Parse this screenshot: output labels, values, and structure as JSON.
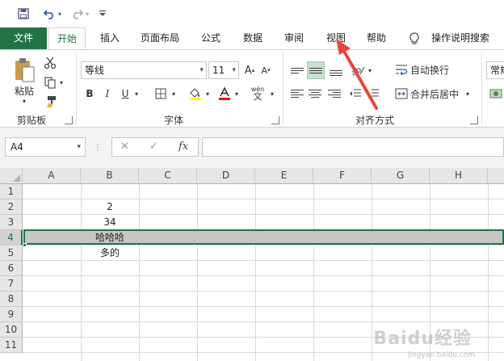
{
  "tabs": [
    {
      "label": "文件"
    },
    {
      "label": "开始"
    },
    {
      "label": "插入"
    },
    {
      "label": "页面布局"
    },
    {
      "label": "公式"
    },
    {
      "label": "数据"
    },
    {
      "label": "审阅"
    },
    {
      "label": "视图"
    },
    {
      "label": "帮助"
    },
    {
      "label": "操作说明搜索"
    }
  ],
  "ribbon": {
    "paste_label": "粘贴",
    "clipboard_group": "剪贴板",
    "font_name": "等线",
    "font_size": "11",
    "font_group": "字体",
    "bold": "B",
    "italic": "I",
    "underline": "U",
    "wen": "wén",
    "wrap_text": "自动换行",
    "merge_center": "合并后居中",
    "alignment_group": "对齐方式",
    "number_format": "常规"
  },
  "formula_bar": {
    "name_box": "A4",
    "fx": "fx",
    "formula": ""
  },
  "grid": {
    "columns": [
      "A",
      "B",
      "C",
      "D",
      "E",
      "F",
      "G",
      "H"
    ],
    "rows": [
      "1",
      "2",
      "3",
      "4",
      "5",
      "6",
      "7",
      "8",
      "9",
      "10",
      "11"
    ],
    "selected_row": "4",
    "cells": {
      "B2": "2",
      "B3": "34",
      "B4": "哈哈哈",
      "B5": "多的"
    }
  },
  "colors": {
    "accent": "#217346",
    "arrow": "#e8463c",
    "fill_color": "#ffff00",
    "font_color": "#ff0000"
  },
  "watermark": {
    "text": "Baidu经验",
    "sub": "jingyan.baidu.com"
  }
}
